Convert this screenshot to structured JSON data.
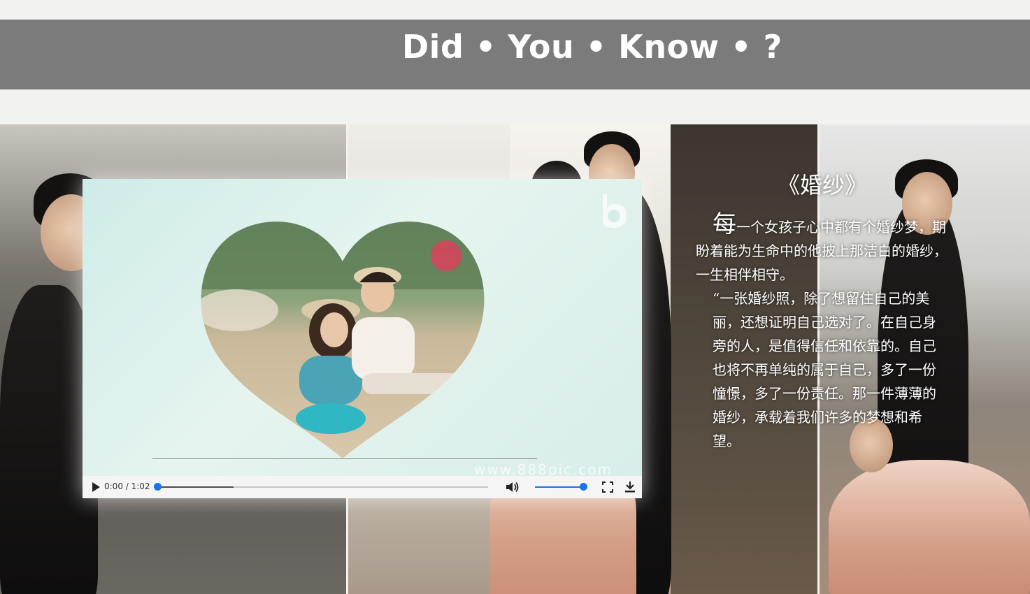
{
  "header": {
    "title": "Did • You • Know •  ?"
  },
  "video": {
    "time": "0:00 / 1:02",
    "progress_percent": 0,
    "buffered_percent": 23,
    "volume_percent": 100,
    "watermark": "www.888pic.com",
    "icons": {
      "play": "play-icon",
      "volume": "volume-icon",
      "fullscreen": "fullscreen-icon",
      "download": "download-icon",
      "logo": "bilibili-logo-icon"
    }
  },
  "poem": {
    "title": "《婚纱》",
    "first_char": "每",
    "line1_rest": "一个女孩子心中都有个婚纱梦，期盼着能为生命中的他披上那洁白的婚纱，一生相伴相守。",
    "paragraph2": "“一张婚纱照，除了想留住自己的美丽，还想证明自己选对了。在自己身旁的人，是值得信任和依靠的。自己也将不再单纯的属于自己，多了一份憧憬，多了一份责任。那一件薄薄的婚纱，承载着我们许多的梦想和希望。"
  },
  "colors": {
    "header_band": "#7b7b7b",
    "page_bg": "#f2f2f1",
    "accent_blue": "#1a73e8"
  }
}
